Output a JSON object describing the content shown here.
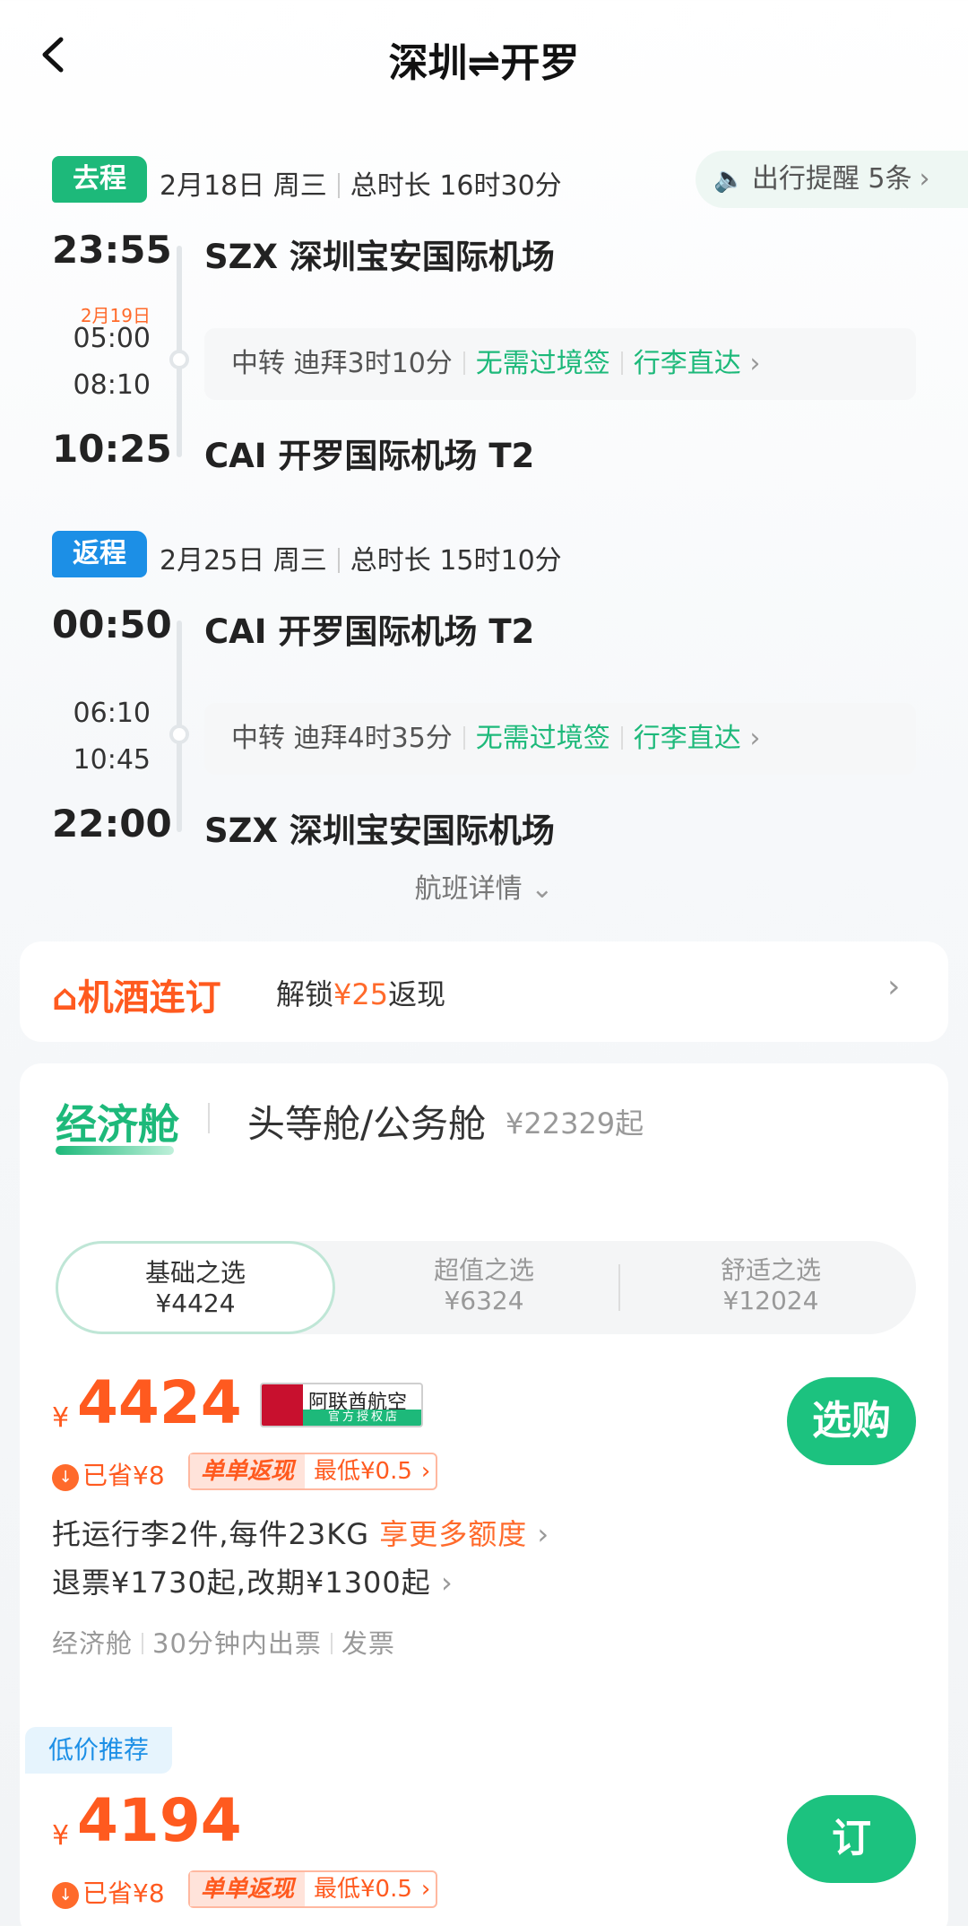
{
  "header": {
    "title": "深圳⇌开罗"
  },
  "outbound": {
    "tag": "去程",
    "date": "2月18日 周三",
    "duration": "总时长 16时30分",
    "depart_time": "23:55",
    "depart_airport": "SZX 深圳宝安国际机场",
    "next_day": "2月19日",
    "transfer_arrive": "05:00",
    "transfer_depart": "08:10",
    "arrive_time": "10:25",
    "arrive_airport": "CAI 开罗国际机场 T2",
    "transfer": {
      "text": "中转 迪拜3时10分",
      "visa": "无需过境签",
      "baggage": "行李直达"
    }
  },
  "reminder": {
    "label": "出行提醒 5条"
  },
  "inbound": {
    "tag": "返程",
    "date": "2月25日 周三",
    "duration": "总时长 15时10分",
    "depart_time": "00:50",
    "depart_airport": "CAI 开罗国际机场 T2",
    "transfer_arrive": "06:10",
    "transfer_depart": "10:45",
    "arrive_time": "22:00",
    "arrive_airport": "SZX 深圳宝安国际机场",
    "transfer": {
      "text": "中转 迪拜4时35分",
      "visa": "无需过境签",
      "baggage": "行李直达"
    }
  },
  "details_link": "航班详情",
  "banner": {
    "logo": "机酒连订",
    "text_pre": "解锁",
    "amount": "¥25",
    "text_post": "返现"
  },
  "cabin_tabs": {
    "economy": "经济舱",
    "first": "头等舱/公务舱",
    "first_price": "¥22329起"
  },
  "fare_options": [
    {
      "name": "基础之选",
      "price": "¥4424"
    },
    {
      "name": "超值之选",
      "price": "¥6324"
    },
    {
      "name": "舒适之选",
      "price": "¥12024"
    }
  ],
  "fare": {
    "currency": "¥",
    "price": "4424",
    "airline_name": "阿联酋航空",
    "airline_sub": "官方授权店",
    "buy_label": "选购",
    "saved": "已省¥8",
    "cashback_label": "单单返现",
    "cashback_low": "最低¥0.5",
    "baggage_text": "托运行李2件,每件23KG",
    "baggage_more": "享更多额度",
    "refund_text": "退票¥1730起,改期¥1300起",
    "meta": [
      "经济舱",
      "30分钟内出票",
      "发票"
    ]
  },
  "recommend": {
    "tag": "低价推荐",
    "currency": "¥",
    "price": "4194",
    "buy_label": "订",
    "saved": "已省¥8",
    "cashback_label": "单单返现",
    "cashback_low": "最低¥0.5"
  },
  "colors": {
    "green": "#1db97a",
    "orange": "#ff5a1f",
    "blue": "#1c8fe6"
  }
}
